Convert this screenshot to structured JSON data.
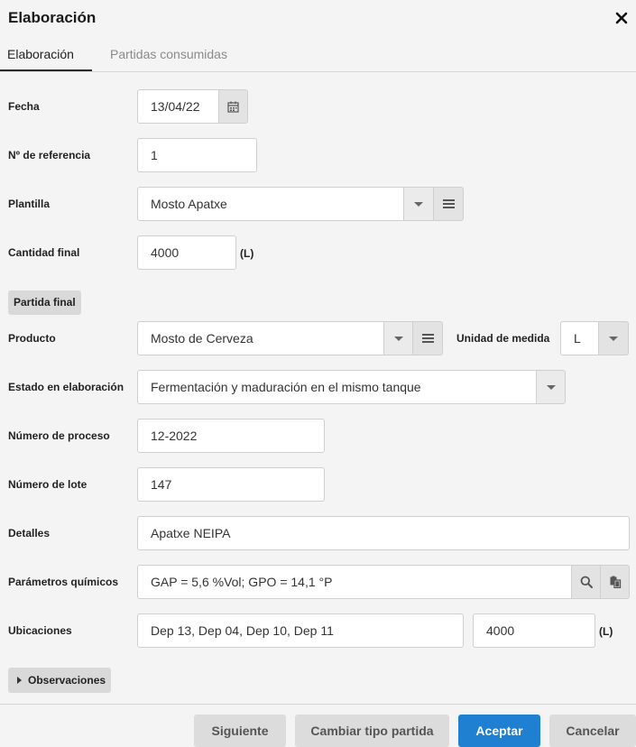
{
  "dialog": {
    "title": "Elaboración"
  },
  "tabs": [
    {
      "label": "Elaboración",
      "active": true
    },
    {
      "label": "Partidas consumidas",
      "active": false
    }
  ],
  "fields": {
    "fecha": {
      "label": "Fecha",
      "value": "13/04/22"
    },
    "referencia": {
      "label": "Nº de referencia",
      "value": "1"
    },
    "plantilla": {
      "label": "Plantilla",
      "value": "Mosto Apatxe"
    },
    "cantidad": {
      "label": "Cantidad final",
      "value": "4000",
      "unit": "(L)"
    }
  },
  "partida_final": {
    "heading": "Partida final",
    "producto": {
      "label": "Producto",
      "value": "Mosto de Cerveza"
    },
    "unidad": {
      "label": "Unidad de medida",
      "value": "L"
    },
    "estado": {
      "label": "Estado en elaboración",
      "value": "Fermentación y maduración en el mismo tanque"
    },
    "proceso": {
      "label": "Número de proceso",
      "value": "12-2022"
    },
    "lote": {
      "label": "Número de lote",
      "value": "147"
    },
    "detalles": {
      "label": "Detalles",
      "value": "Apatxe NEIPA"
    },
    "parametros": {
      "label": "Parámetros químicos",
      "value": "GAP = 5,6 %Vol; GPO = 14,1 °P"
    },
    "ubicaciones": {
      "label": "Ubicaciones",
      "value": "Dep 13, Dep 04, Dep 10, Dep 11",
      "qty": "4000",
      "unit": "(L)"
    }
  },
  "observaciones": {
    "label": "Observaciones"
  },
  "footer": {
    "siguiente": "Siguiente",
    "cambiar": "Cambiar tipo partida",
    "aceptar": "Aceptar",
    "cancelar": "Cancelar"
  },
  "colors": {
    "primary": "#1f7fd0",
    "background": "#f4f4f4"
  }
}
